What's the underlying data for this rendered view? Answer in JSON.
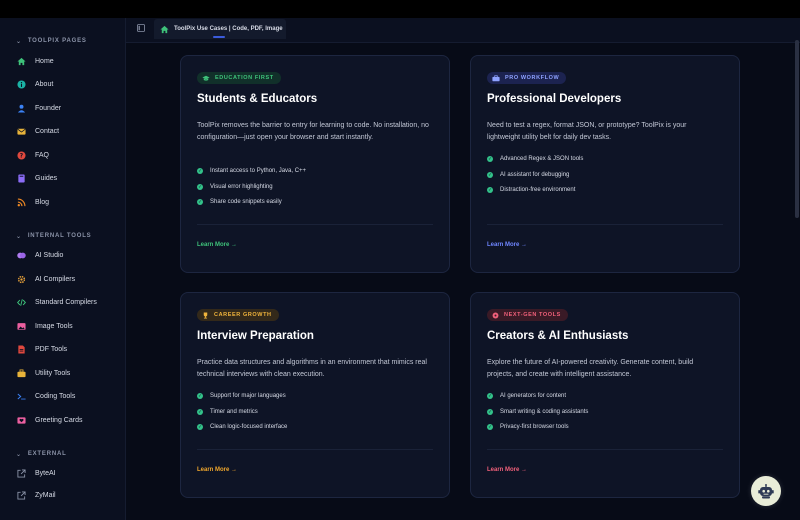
{
  "tab": {
    "title": "ToolPix Use Cases | Code, PDF, Image"
  },
  "sidebar": {
    "sections": [
      {
        "label": "TOOLPIX PAGES"
      },
      {
        "label": "INTERNAL TOOLS"
      },
      {
        "label": "EXTERNAL"
      }
    ],
    "pages": [
      {
        "label": "Home",
        "icon": "home-icon",
        "color": "#3ec27a"
      },
      {
        "label": "About",
        "icon": "info-icon",
        "color": "#1bb3a6"
      },
      {
        "label": "Founder",
        "icon": "user-icon",
        "color": "#3b82f6"
      },
      {
        "label": "Contact",
        "icon": "mail-icon",
        "color": "#e8b33a"
      },
      {
        "label": "FAQ",
        "icon": "question-icon",
        "color": "#e0483e"
      },
      {
        "label": "Guides",
        "icon": "book-icon",
        "color": "#8b6cf6"
      },
      {
        "label": "Blog",
        "icon": "rss-icon",
        "color": "#f08a24"
      }
    ],
    "internal": [
      {
        "label": "AI Studio",
        "icon": "brain-icon",
        "color": "#b07cf0"
      },
      {
        "label": "AI Compilers",
        "icon": "gear-icon",
        "color": "#e8a23a"
      },
      {
        "label": "Standard Compilers",
        "icon": "code-icon",
        "color": "#3ec27a"
      },
      {
        "label": "Image Tools",
        "icon": "image-icon",
        "color": "#ec5fa0"
      },
      {
        "label": "PDF Tools",
        "icon": "pdf-icon",
        "color": "#e0483e"
      },
      {
        "label": "Utility Tools",
        "icon": "toolbox-icon",
        "color": "#e8b33a"
      },
      {
        "label": "Coding Tools",
        "icon": "terminal-icon",
        "color": "#3b82f6"
      },
      {
        "label": "Greeting Cards",
        "icon": "card-icon",
        "color": "#ec5fa0"
      }
    ],
    "external": [
      {
        "label": "ByteAI",
        "icon": "external-link-icon",
        "color": "#8b93a8"
      },
      {
        "label": "ZyMail",
        "icon": "external-link-icon",
        "color": "#8b93a8"
      }
    ]
  },
  "cards": [
    {
      "badge": "EDUCATION FIRST",
      "badge_color": "#3ec27a",
      "badge_bg": "#11302a",
      "title": "Students & Educators",
      "desc": "ToolPix removes the barrier to entry for learning to code. No installation, no configuration—just open your browser and start instantly.",
      "features": [
        "Instant access to Python, Java, C++",
        "Visual error highlighting",
        "Share code snippets easily"
      ],
      "link": "Learn More →",
      "link_color": "#3ec27a"
    },
    {
      "badge": "PRO WORKFLOW",
      "badge_color": "#8ea2ff",
      "badge_bg": "#1c2350",
      "title": "Professional Developers",
      "desc": "Need to test a regex, format JSON, or prototype? ToolPix is your lightweight utility belt for daily dev tasks.",
      "features": [
        "Advanced Regex & JSON tools",
        "AI assistant for debugging",
        "Distraction-free environment"
      ],
      "link": "Learn More →",
      "link_color": "#6f86ff"
    },
    {
      "badge": "CAREER GROWTH",
      "badge_color": "#f0b43c",
      "badge_bg": "#33291a",
      "title": "Interview Preparation",
      "desc": "Practice data structures and algorithms in an environment that mimics real technical interviews with clean execution.",
      "features": [
        "Support for major languages",
        "Timer and metrics",
        "Clean logic-focused interface"
      ],
      "link": "Learn More →",
      "link_color": "#f0a72c"
    },
    {
      "badge": "NEXT-GEN TOOLS",
      "badge_color": "#f0607a",
      "badge_bg": "#3a1a26",
      "title": "Creators & AI Enthusiasts",
      "desc": "Explore the future of AI-powered creativity. Generate content, build projects, and create with intelligent assistance.",
      "features": [
        "AI generators for content",
        "Smart writing & coding assistants",
        "Privacy-first browser tools"
      ],
      "link": "Learn More →",
      "link_color": "#f0607a"
    }
  ]
}
